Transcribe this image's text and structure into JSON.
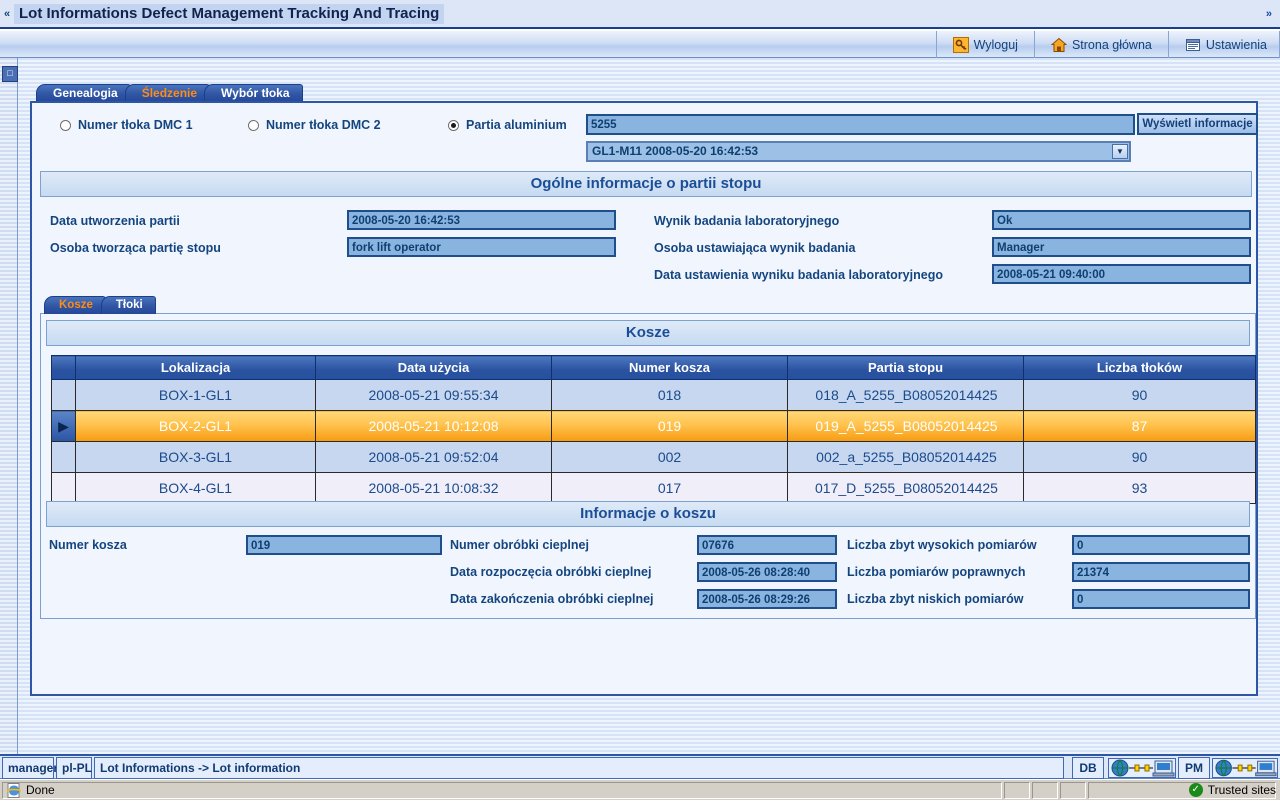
{
  "window": {
    "title": "Lot Informations Defect Management Tracking And Tracing",
    "chevron_left": "«",
    "chevron_right": "»"
  },
  "toolbar": {
    "items": [
      {
        "label": "Wyloguj",
        "icon": "key-icon",
        "glyph": "🔑"
      },
      {
        "label": "Strona główna",
        "icon": "home-icon",
        "glyph": "🏠"
      },
      {
        "label": "Ustawienia",
        "icon": "settings-document-icon",
        "glyph": "🗂"
      }
    ]
  },
  "tabs": [
    {
      "label": "Genealogia",
      "active": false
    },
    {
      "label": "Śledzenie",
      "active": true
    },
    {
      "label": "Wybór tłoka",
      "active": false
    }
  ],
  "search": {
    "radios": [
      {
        "label": "Numer tłoka DMC 1",
        "selected": false
      },
      {
        "label": "Numer tłoka DMC 2",
        "selected": false
      },
      {
        "label": "Partia aluminium",
        "selected": true
      }
    ],
    "lot_value": "5255",
    "show_button": "Wyświetl informacje",
    "combo_value": "GL1-M11 2008-05-20 16:42:53",
    "combo_arrow": "▼"
  },
  "general": {
    "header": "Ogólne informacje o partii stopu",
    "left": [
      {
        "label": "Data utworzenia partii",
        "value": "2008-05-20 16:42:53"
      },
      {
        "label": "Osoba tworząca partię stopu",
        "value": "fork lift operator"
      }
    ],
    "right": [
      {
        "label": "Wynik badania laboratoryjnego",
        "value": "Ok"
      },
      {
        "label": "Osoba ustawiająca wynik badania",
        "value": "Manager"
      },
      {
        "label": "Data ustawienia wyniku badania laboratoryjnego",
        "value": "2008-05-21 09:40:00"
      }
    ]
  },
  "inner_tabs": [
    {
      "label": "Kosze",
      "active": true
    },
    {
      "label": "Tłoki",
      "active": false
    }
  ],
  "grid": {
    "header": "Kosze",
    "row_marker": "▶",
    "columns": [
      "Lokalizacja",
      "Data użycia",
      "Numer kosza",
      "Partia stopu",
      "Liczba tłoków"
    ],
    "rows": [
      {
        "cells": [
          "BOX-1-GL1",
          "2008-05-21 09:55:34",
          "018",
          "018_A_5255_B08052014425",
          "90"
        ],
        "selected": false,
        "alt": false
      },
      {
        "cells": [
          "BOX-2-GL1",
          "2008-05-21 10:12:08",
          "019",
          "019_A_5255_B08052014425",
          "87"
        ],
        "selected": true,
        "alt": false
      },
      {
        "cells": [
          "BOX-3-GL1",
          "2008-05-21 09:52:04",
          "002",
          "002_a_5255_B08052014425",
          "90"
        ],
        "selected": false,
        "alt": false
      },
      {
        "cells": [
          "BOX-4-GL1",
          "2008-05-21 10:08:32",
          "017",
          "017_D_5255_B08052014425",
          "93"
        ],
        "selected": false,
        "alt": true
      }
    ]
  },
  "basket": {
    "header": "Informacje o koszu",
    "col1": [
      {
        "label": "Numer kosza",
        "value": "019"
      }
    ],
    "col2": [
      {
        "label": "Numer obróbki cieplnej",
        "value": "07676"
      },
      {
        "label": "Data rozpoczęcia obróbki cieplnej",
        "value": "2008-05-26 08:28:40"
      },
      {
        "label": "Data zakończenia obróbki cieplnej",
        "value": "2008-05-26 08:29:26"
      }
    ],
    "col3": [
      {
        "label": "Liczba zbyt wysokich pomiarów",
        "value": "0"
      },
      {
        "label": "Liczba pomiarów poprawnych",
        "value": "21374"
      },
      {
        "label": "Liczba zbyt niskich pomiarów",
        "value": "0"
      }
    ]
  },
  "statusbar": {
    "user": "manager",
    "locale": "pl-PL",
    "breadcrumb": "Lot Informations -> Lot information",
    "db_label": "DB",
    "pm_label": "PM"
  },
  "browser_status": {
    "text": "Done",
    "zone": "Trusted sites",
    "ie_icon": "ie-page-icon",
    "zone_icon": "shield-check-icon"
  },
  "colors": {
    "accent_blue": "#2a52a0",
    "active_tab_orange": "#ff8c18",
    "selected_row": "#f79b12",
    "field_bg": "#89b4e0"
  }
}
